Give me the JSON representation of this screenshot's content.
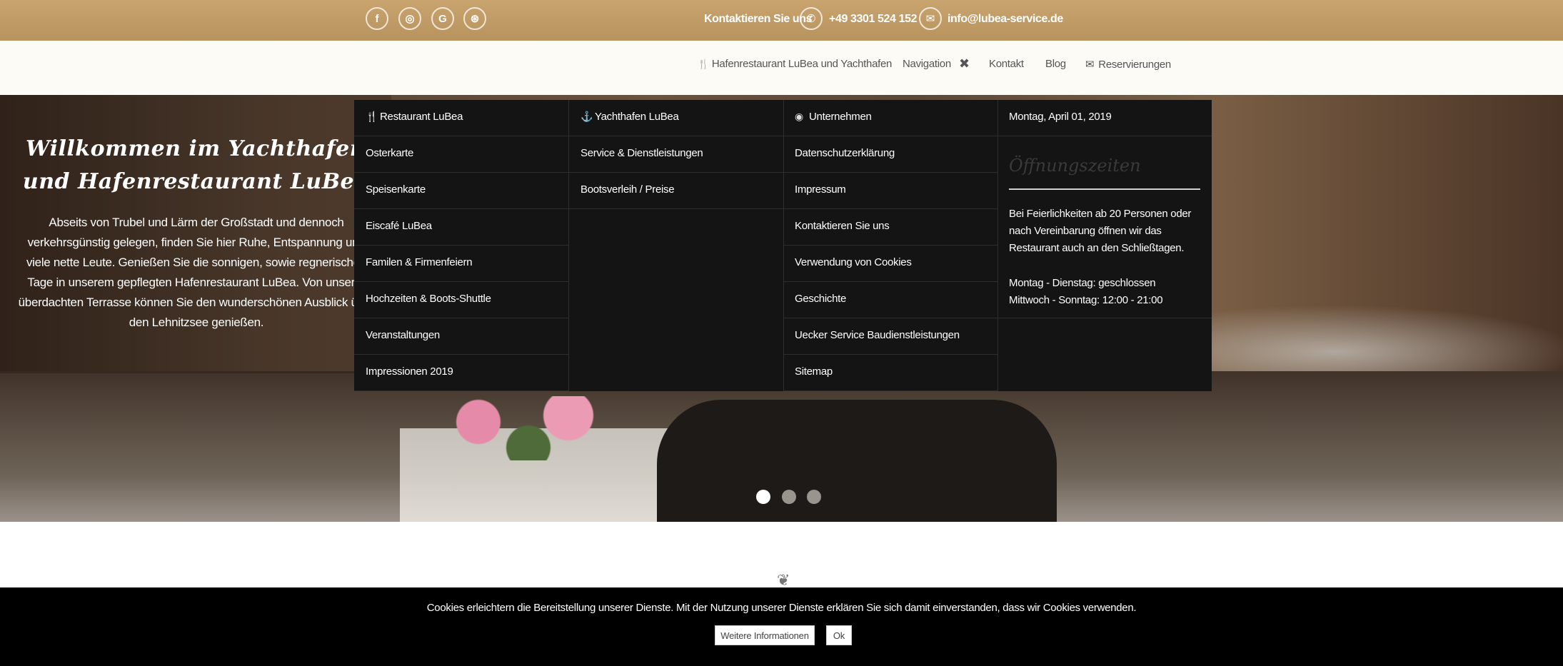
{
  "topbar": {
    "social": [
      {
        "name": "facebook-icon",
        "glyph": "f"
      },
      {
        "name": "instagram-icon",
        "glyph": "◎"
      },
      {
        "name": "google-icon",
        "glyph": "G"
      },
      {
        "name": "dribbble-icon",
        "glyph": "⊛"
      }
    ],
    "contact_label": "Kontaktieren Sie uns",
    "phone_glyph": "✆",
    "phone": "+49 3301 524 152",
    "email_glyph": "✉",
    "email": "info@lubea-service.de"
  },
  "nav": {
    "home": "Hafenrestaurant LuBea und Yachthafen",
    "home_glyph": "🍴",
    "navigation": "Navigation",
    "close_glyph": "✖",
    "kontakt": "Kontakt",
    "blog": "Blog",
    "reservations": "Reservierungen",
    "reservations_glyph": "✉"
  },
  "hero": {
    "title": "Willkommen im Yachthafen und Hafenrestaurant LuBea",
    "text": "Abseits von Trubel und Lärm der Großstadt und dennoch verkehrsgünstig gelegen, finden Sie hier Ruhe, Entspannung und viele nette Leute. Genießen Sie die sonnigen, sowie regnerischen Tage in unserem gepflegten Hafenrestaurant LuBea. Von unserer überdachten Terrasse können Sie den wunderschönen Ausblick über den Lehnitzsee genießen.",
    "active_slide": 1,
    "slide_count": 3
  },
  "menu": {
    "restaurant": {
      "heading": "Restaurant LuBea",
      "heading_glyph": "🍴",
      "items": [
        "Osterkarte",
        "Speisenkarte",
        "Eiscafé LuBea",
        "Familen & Firmenfeiern",
        "Hochzeiten & Boots-Shuttle",
        "Veranstaltungen",
        "Impressionen 2019"
      ]
    },
    "yachthafen": {
      "heading": "Yachthafen LuBea",
      "heading_glyph": "⚓",
      "items": [
        "Service & Dienstleistungen",
        "Bootsverleih / Preise"
      ]
    },
    "unternehmen": {
      "heading": "Unternehmen",
      "heading_glyph": "◉",
      "items": [
        "Datenschutzerklärung",
        "Impressum",
        "Kontaktieren Sie uns",
        "Verwendung von Cookies",
        "Geschichte",
        "Uecker Service Baudienstleistungen",
        "Sitemap"
      ]
    },
    "side": {
      "date": "Montag, April 01, 2019",
      "hours_title": "Öffnungszeiten",
      "note": "Bei Feierlichkeiten ab 20 Personen oder nach Vereinbarung öffnen wir das Restaurant auch an den Schließtagen.",
      "line1": "Montag - Dienstag: geschlossen",
      "line2": "Mittwoch - Sonntag: 12:00 - 21:00"
    }
  },
  "lower": {
    "leaf_glyph": "❦"
  },
  "cookie": {
    "message": "Cookies erleichtern die Bereitstellung unserer Dienste. Mit der Nutzung unserer Dienste erklären Sie sich damit einverstanden, dass wir Cookies verwenden.",
    "more": "Weitere Informationen",
    "ok": "Ok"
  },
  "colors": {
    "topbar": "#c9a46e",
    "menu_bg": "#141414",
    "cookie_bg": "#000000"
  }
}
